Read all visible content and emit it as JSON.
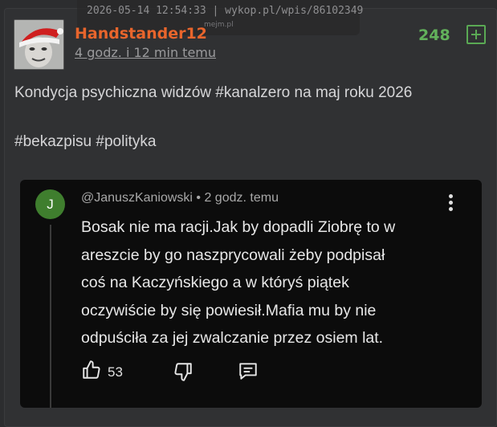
{
  "watermark": {
    "timestamp_source": "2026-05-14 12:54:33 | wykop.pl/wpis/86102349",
    "site": "mejm.pl"
  },
  "post": {
    "author": "Handstander12",
    "time_ago": "4 godz. i 12 min temu",
    "votes": "248",
    "text_before": "Kondycja psychiczna widzów ",
    "hashtag_main": "#kanalzero",
    "text_after": " na maj roku 2026",
    "tags": [
      "#bekazpisu",
      "#polityka"
    ]
  },
  "comment": {
    "avatar_letter": "J",
    "author_line": "@JanuszKaniowski • 2 godz. temu",
    "lines": [
      "Bosak nie ma racji.Jak by dopadli Ziobrę to w",
      "areszcie by go naszprycowali żeby podpisał",
      "coś na Kaczyńskiego a w któryś piątek",
      "oczywiście by się powiesił.Mafia mu by nie",
      "odpuściła za jej zwalczanie przez osiem lat."
    ],
    "likes": "53"
  },
  "colors": {
    "author": "#e8652c",
    "votes": "#62b15b",
    "comment_avatar": "#3f7e2e"
  },
  "icons": [
    "plus-square-icon",
    "thumbs-up-icon",
    "thumbs-down-icon",
    "reply-comment-icon",
    "kebab-menu-icon"
  ]
}
